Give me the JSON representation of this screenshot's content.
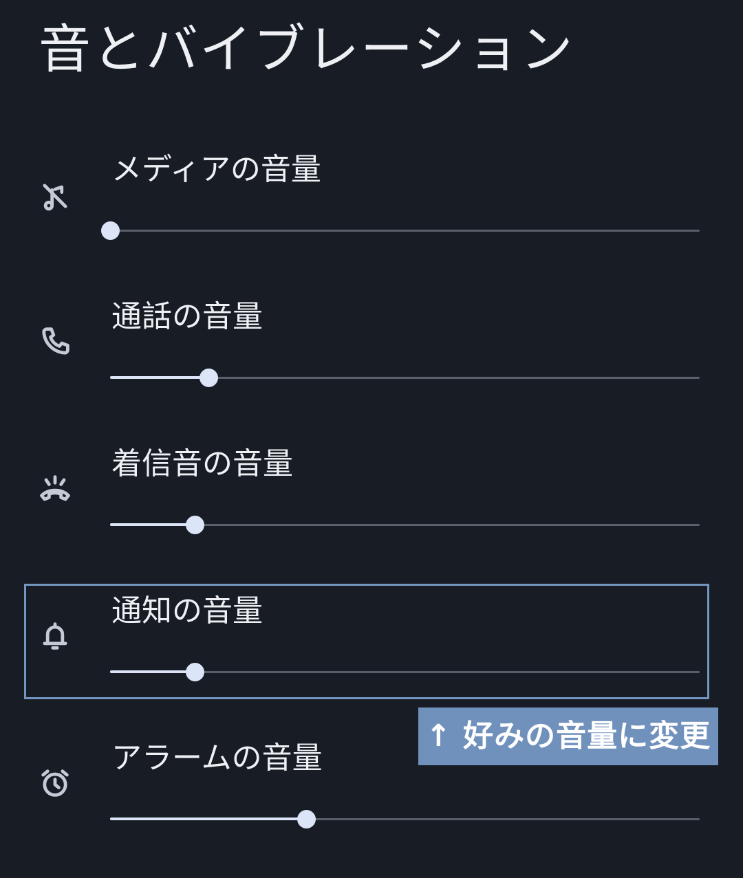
{
  "header": {
    "title": "音とバイブレーション"
  },
  "volume_rows": [
    {
      "label": "メディアの音量",
      "icon": "music-note-off-icon",
      "level": 0.0
    },
    {
      "label": "通話の音量",
      "icon": "phone-icon",
      "level": 0.167
    },
    {
      "label": "着信音の音量",
      "icon": "phone-ringing-icon",
      "level": 0.143
    },
    {
      "label": "通知の音量",
      "icon": "bell-icon",
      "level": 0.143
    },
    {
      "label": "アラームの音量",
      "icon": "alarm-clock-icon",
      "level": 0.333
    }
  ],
  "annotation": {
    "text": "↑ 好みの音量に変更"
  },
  "colors": {
    "background": "#171c25",
    "accent": "#dbe5f7",
    "track": "#5a5f69",
    "highlight": "#7496c1",
    "annotation_bg": "#7191bd"
  }
}
